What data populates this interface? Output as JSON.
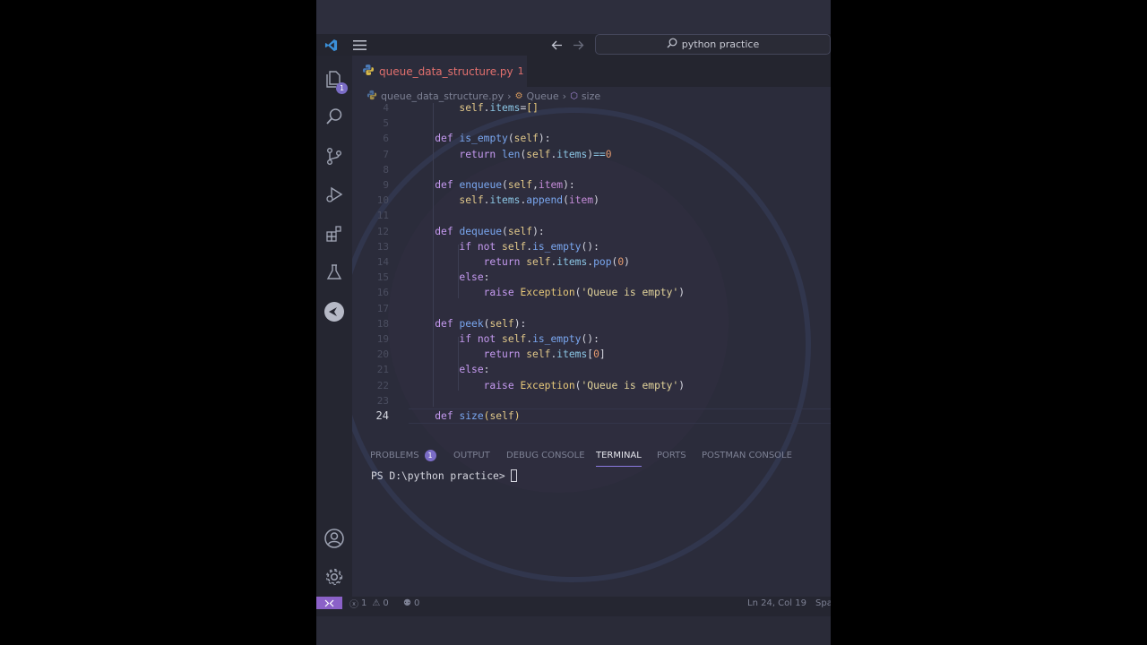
{
  "window": {
    "search_text": "python practice",
    "colors": {
      "accent": "#8b61c8",
      "badge": "#7a6cc6",
      "modified_tab": "#e2706e"
    }
  },
  "activity_bar": {
    "icons": [
      "explorer-icon",
      "search-icon",
      "source-control-icon",
      "run-debug-icon",
      "extensions-icon",
      "testing-icon",
      "postman-icon",
      "account-icon",
      "settings-gear-icon"
    ],
    "explorer_badge": "1"
  },
  "tab": {
    "filename": "queue_data_structure.py",
    "problem_count": "1"
  },
  "breadcrumb": {
    "file": "queue_data_structure.py",
    "class": "Queue",
    "method": "size"
  },
  "editor": {
    "current_line": "24",
    "lines": [
      {
        "num": "4",
        "tokens": [
          {
            "t": "        "
          },
          {
            "t": "self",
            "c": "sf"
          },
          {
            "t": "."
          },
          {
            "t": "items",
            "c": "op"
          },
          {
            "t": "="
          },
          {
            "t": "[]",
            "c": "cl"
          }
        ]
      },
      {
        "num": "5",
        "tokens": []
      },
      {
        "num": "6",
        "tokens": [
          {
            "t": "    "
          },
          {
            "t": "def ",
            "c": "kw"
          },
          {
            "t": "is_empty",
            "c": "fn"
          },
          {
            "t": "("
          },
          {
            "t": "self",
            "c": "sf"
          },
          {
            "t": "):"
          }
        ]
      },
      {
        "num": "7",
        "tokens": [
          {
            "t": "        "
          },
          {
            "t": "return ",
            "c": "kw"
          },
          {
            "t": "len",
            "c": "fn"
          },
          {
            "t": "("
          },
          {
            "t": "self",
            "c": "sf"
          },
          {
            "t": "."
          },
          {
            "t": "items",
            "c": "op"
          },
          {
            "t": ")"
          },
          {
            "t": "==",
            "c": "op"
          },
          {
            "t": "0",
            "c": "nm"
          }
        ]
      },
      {
        "num": "8",
        "tokens": []
      },
      {
        "num": "9",
        "tokens": [
          {
            "t": "    "
          },
          {
            "t": "def ",
            "c": "kw"
          },
          {
            "t": "enqueue",
            "c": "fn"
          },
          {
            "t": "("
          },
          {
            "t": "self",
            "c": "sf"
          },
          {
            "t": ","
          },
          {
            "t": "item",
            "c": "pm"
          },
          {
            "t": "):"
          }
        ]
      },
      {
        "num": "10",
        "tokens": [
          {
            "t": "        "
          },
          {
            "t": "self",
            "c": "sf"
          },
          {
            "t": "."
          },
          {
            "t": "items",
            "c": "op"
          },
          {
            "t": "."
          },
          {
            "t": "append",
            "c": "fn"
          },
          {
            "t": "("
          },
          {
            "t": "item",
            "c": "pm"
          },
          {
            "t": ")"
          }
        ]
      },
      {
        "num": "11",
        "tokens": []
      },
      {
        "num": "12",
        "tokens": [
          {
            "t": "    "
          },
          {
            "t": "def ",
            "c": "kw"
          },
          {
            "t": "dequeue",
            "c": "fn"
          },
          {
            "t": "("
          },
          {
            "t": "self",
            "c": "sf"
          },
          {
            "t": "):"
          }
        ]
      },
      {
        "num": "13",
        "tokens": [
          {
            "t": "        "
          },
          {
            "t": "if not ",
            "c": "kw"
          },
          {
            "t": "self",
            "c": "sf"
          },
          {
            "t": "."
          },
          {
            "t": "is_empty",
            "c": "fn"
          },
          {
            "t": "():"
          }
        ]
      },
      {
        "num": "14",
        "tokens": [
          {
            "t": "            "
          },
          {
            "t": "return ",
            "c": "kw"
          },
          {
            "t": "self",
            "c": "sf"
          },
          {
            "t": "."
          },
          {
            "t": "items",
            "c": "op"
          },
          {
            "t": "."
          },
          {
            "t": "pop",
            "c": "fn"
          },
          {
            "t": "("
          },
          {
            "t": "0",
            "c": "nm"
          },
          {
            "t": ")"
          }
        ]
      },
      {
        "num": "15",
        "tokens": [
          {
            "t": "        "
          },
          {
            "t": "else",
            "c": "kw"
          },
          {
            "t": ":"
          }
        ]
      },
      {
        "num": "16",
        "tokens": [
          {
            "t": "            "
          },
          {
            "t": "raise ",
            "c": "kw"
          },
          {
            "t": "Exception",
            "c": "cl"
          },
          {
            "t": "("
          },
          {
            "t": "'Queue is empty'",
            "c": "st"
          },
          {
            "t": ")"
          }
        ]
      },
      {
        "num": "17",
        "tokens": []
      },
      {
        "num": "18",
        "tokens": [
          {
            "t": "    "
          },
          {
            "t": "def ",
            "c": "kw"
          },
          {
            "t": "peek",
            "c": "fn"
          },
          {
            "t": "("
          },
          {
            "t": "self",
            "c": "sf"
          },
          {
            "t": "):"
          }
        ]
      },
      {
        "num": "19",
        "tokens": [
          {
            "t": "        "
          },
          {
            "t": "if not ",
            "c": "kw"
          },
          {
            "t": "self",
            "c": "sf"
          },
          {
            "t": "."
          },
          {
            "t": "is_empty",
            "c": "fn"
          },
          {
            "t": "():"
          }
        ]
      },
      {
        "num": "20",
        "tokens": [
          {
            "t": "            "
          },
          {
            "t": "return ",
            "c": "kw"
          },
          {
            "t": "self",
            "c": "sf"
          },
          {
            "t": "."
          },
          {
            "t": "items",
            "c": "op"
          },
          {
            "t": "["
          },
          {
            "t": "0",
            "c": "nm"
          },
          {
            "t": "]"
          }
        ]
      },
      {
        "num": "21",
        "tokens": [
          {
            "t": "        "
          },
          {
            "t": "else",
            "c": "kw"
          },
          {
            "t": ":"
          }
        ]
      },
      {
        "num": "22",
        "tokens": [
          {
            "t": "            "
          },
          {
            "t": "raise ",
            "c": "kw"
          },
          {
            "t": "Exception",
            "c": "cl"
          },
          {
            "t": "("
          },
          {
            "t": "'Queue is empty'",
            "c": "st"
          },
          {
            "t": ")"
          }
        ]
      },
      {
        "num": "23",
        "tokens": []
      },
      {
        "num": "24",
        "tokens": [
          {
            "t": "    "
          },
          {
            "t": "def ",
            "c": "kw"
          },
          {
            "t": "size",
            "c": "fn"
          },
          {
            "t": "(",
            "c": "cl"
          },
          {
            "t": "self",
            "c": "sf"
          },
          {
            "t": ")",
            "c": "cl"
          }
        ]
      }
    ]
  },
  "panel": {
    "tabs": [
      {
        "label": "PROBLEMS",
        "badge": "1"
      },
      {
        "label": "OUTPUT"
      },
      {
        "label": "DEBUG CONSOLE"
      },
      {
        "label": "TERMINAL",
        "active": true
      },
      {
        "label": "PORTS"
      },
      {
        "label": "POSTMAN CONSOLE"
      }
    ],
    "terminal_prompt": "PS D:\\python practice>"
  },
  "status_bar": {
    "errors": "1",
    "warnings": "0",
    "ports": "0",
    "cursor_position": "Ln 24, Col 19",
    "spaces": "Spa"
  }
}
